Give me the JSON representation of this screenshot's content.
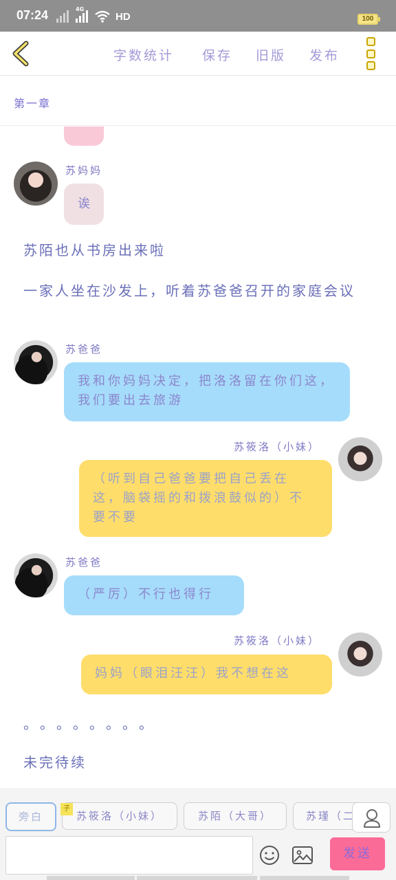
{
  "status_bar": {
    "time": "07:24",
    "network_tag": "4G",
    "hd_label": "HD",
    "battery": "100"
  },
  "toolbar": {
    "word_count": "字数统计",
    "save": "保存",
    "old_version": "旧版",
    "publish": "发布"
  },
  "chapter": {
    "title": "第一章"
  },
  "messages": [
    {
      "speaker": "苏妈妈",
      "text": "诶",
      "side": "left"
    },
    {
      "narration": "苏陌也从书房出来啦"
    },
    {
      "narration": "一家人坐在沙发上，听着苏爸爸召开的家庭会议"
    },
    {
      "speaker": "苏爸爸",
      "text": "我和你妈妈决定，把洛洛留在你们这，我们要出去旅游",
      "side": "left"
    },
    {
      "speaker": "苏筱洛（小妹）",
      "text": "（听到自己爸爸要把自己丢在这，脑袋摇的和拨浪鼓似的）不要不要",
      "side": "right"
    },
    {
      "speaker": "苏爸爸",
      "text": "（严厉）不行也得行",
      "side": "left"
    },
    {
      "speaker": "苏筱洛（小妹）",
      "text": "妈妈（眼泪汪汪）我不想在这",
      "side": "right"
    },
    {
      "narration": "。。。。。。。。"
    },
    {
      "narration": "未完待续"
    }
  ],
  "bottom": {
    "roles": [
      "旁白",
      "苏筱洛（小妹）",
      "苏陌（大哥）",
      "苏瑾（二"
    ],
    "pin_label": "子",
    "input_placeholder": "",
    "send": "发送"
  }
}
